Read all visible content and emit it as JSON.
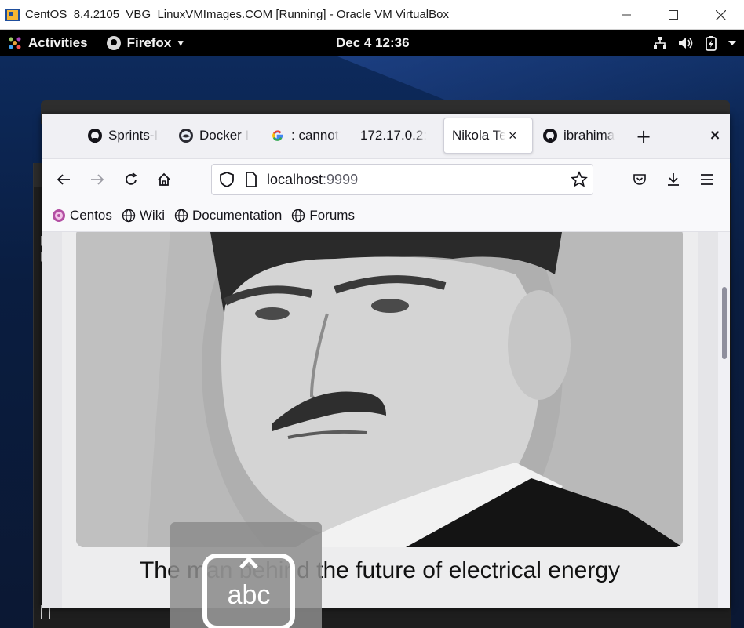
{
  "host_window": {
    "title": "CentOS_8.4.2105_VBG_LinuxVMImages.COM [Running] - Oracle VM VirtualBox",
    "icon": "virtualbox-icon",
    "controls": {
      "minimize": "minimize-icon",
      "maximize": "maximize-icon",
      "close": "close-icon"
    }
  },
  "gnome_bar": {
    "activities_label": "Activities",
    "app_menu_label": "Firefox",
    "clock": "Dec 4  12:36",
    "tray_icons": [
      "network-icon",
      "volume-icon",
      "battery-icon",
      "power-menu-icon"
    ]
  },
  "browser": {
    "tabs": [
      {
        "label": "Sprints-I",
        "icon": "github-icon",
        "active": false
      },
      {
        "label": "Docker I",
        "icon": "docker-icon",
        "active": false
      },
      {
        "label": ": cannot",
        "icon": "google-icon",
        "active": false
      },
      {
        "label": "172.17.0.2:",
        "icon": "",
        "active": false
      },
      {
        "label": "Nikola Te",
        "icon": "",
        "active": true
      },
      {
        "label": "ibrahima",
        "icon": "github-icon",
        "active": false
      }
    ],
    "new_tab_label": "+",
    "close_window_label": "×",
    "tab_close_label": "×",
    "url_host": "localhost",
    "url_port": ":9999",
    "bookmarks": [
      {
        "label": "Centos",
        "icon": "centos-icon"
      },
      {
        "label": "Wiki",
        "icon": "globe-icon"
      },
      {
        "label": "Documentation",
        "icon": "globe-icon"
      },
      {
        "label": "Forums",
        "icon": "globe-icon"
      }
    ]
  },
  "page": {
    "caption": "The man behind the future of electrical energy",
    "image_subject": "portrait-photo"
  },
  "osk": {
    "label": "abc"
  },
  "colors": {
    "gnome_bar": "#000000",
    "desktop": "#0d2a5c",
    "browser_chrome": "#f0f0f4",
    "active_tab": "#ffffff"
  }
}
